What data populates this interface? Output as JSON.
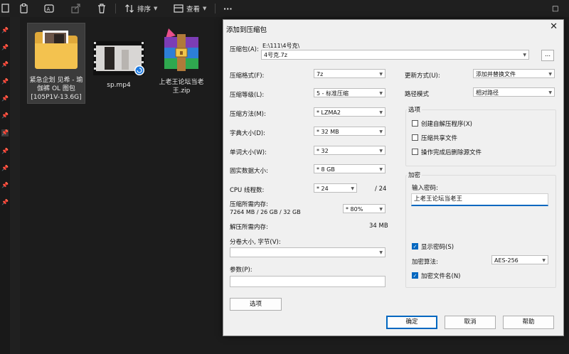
{
  "toolbar": {
    "sort_label": "排序",
    "view_label": "查看",
    "more_label": "···",
    "restore_label": "□"
  },
  "files": [
    {
      "label": "紧急企划 见希 - 瑜伽裤 OL 图包 [105P1V-13.6G]"
    },
    {
      "label": "sp.mp4"
    },
    {
      "label": "上老王论坛当老王.zip"
    }
  ],
  "dialog": {
    "title": "添加到压缩包",
    "close_label": "✕",
    "archive_label": "压缩包(A):",
    "archive_path": "E:\\111\\4号克\\",
    "archive_name": "4号克.7z",
    "browse_label": "...",
    "format_label": "压缩格式(F):",
    "format_value": "7z",
    "level_label": "压缩等级(L):",
    "level_value": "5 - 标准压缩",
    "method_label": "压缩方法(M):",
    "method_value": "* LZMA2",
    "dict_label": "字典大小(D):",
    "dict_value": "* 32 MB",
    "word_label": "单词大小(W):",
    "word_value": "* 32",
    "solid_label": "固实数据大小:",
    "solid_value": "* 8 GB",
    "cpu_label": "CPU 线程数:",
    "cpu_value": "* 24",
    "cpu_total": "/ 24",
    "mem_label": "压缩所需内存:",
    "mem_detail": "7264 MB / 26 GB / 32 GB",
    "mem_value": "* 80%",
    "demem_label": "解压所需内存:",
    "demem_value": "34 MB",
    "split_label": "分卷大小, 字节(V):",
    "split_value": "",
    "params_label": "参数(P):",
    "params_value": "",
    "options_button": "选项",
    "update_label": "更新方式(U):",
    "update_value": "添加并替换文件",
    "path_label": "路径模式",
    "path_value": "相对路径",
    "options_group": "选项",
    "opt_sfx": "创建自解压程序(X)",
    "opt_shared": "压缩共享文件",
    "opt_delete": "操作完成后删除源文件",
    "encrypt_group": "加密",
    "password_label": "输入密码:",
    "password_value": "上老王论坛当老王",
    "show_password": "显示密码(S)",
    "method_enc_label": "加密算法:",
    "method_enc_value": "AES-256",
    "encrypt_names": "加密文件名(N)",
    "ok_label": "确定",
    "cancel_label": "取消",
    "help_label": "帮助"
  },
  "colors": {
    "accent": "#0067c0",
    "explorer_bg": "#1c1c1c",
    "dialog_bg": "#f0f0f0"
  }
}
